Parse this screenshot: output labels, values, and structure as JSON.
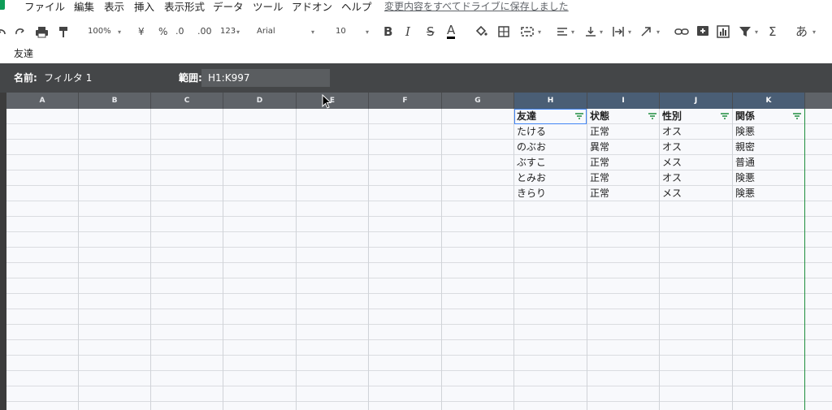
{
  "menu": {
    "items": [
      "ファイル",
      "編集",
      "表示",
      "挿入",
      "表示形式",
      "データ",
      "ツール",
      "アドオン",
      "ヘルプ"
    ],
    "save_status": "変更内容をすべてドライブに保存しました"
  },
  "toolbar": {
    "zoom": "100%",
    "currency": "¥",
    "percent": "%",
    "decrease_decimals": ".0",
    "increase_decimals": ".00",
    "more_formats": "123",
    "font": "Arial",
    "font_size": "10",
    "bold": "B",
    "italic": "I",
    "strikethrough": "S",
    "text_color": "A",
    "sum": "Σ",
    "input_tools": "あ"
  },
  "sheet_label": "友達",
  "filter_bar": {
    "name_label": "名前:",
    "name_value": "フィルタ 1",
    "range_label": "範囲:",
    "range_value": "H1:K997"
  },
  "columns": [
    "A",
    "B",
    "C",
    "D",
    "E",
    "F",
    "G",
    "H",
    "I",
    "J",
    "K"
  ],
  "table": {
    "headers": [
      "友達",
      "状態",
      "性別",
      "関係"
    ],
    "rows": [
      [
        "たける",
        "正常",
        "オス",
        "険悪"
      ],
      [
        "のぶお",
        "異常",
        "オス",
        "親密"
      ],
      [
        "ぶすこ",
        "正常",
        "メス",
        "普通"
      ],
      [
        "とみお",
        "正常",
        "オス",
        "険悪"
      ],
      [
        "きらり",
        "正常",
        "メス",
        "険悪"
      ]
    ]
  },
  "colors": {
    "filter_bar": "#444648",
    "selected_header": "#4a5e75",
    "filter_border": "#1e8e3e",
    "filter_icon": "#1e8e3e"
  }
}
